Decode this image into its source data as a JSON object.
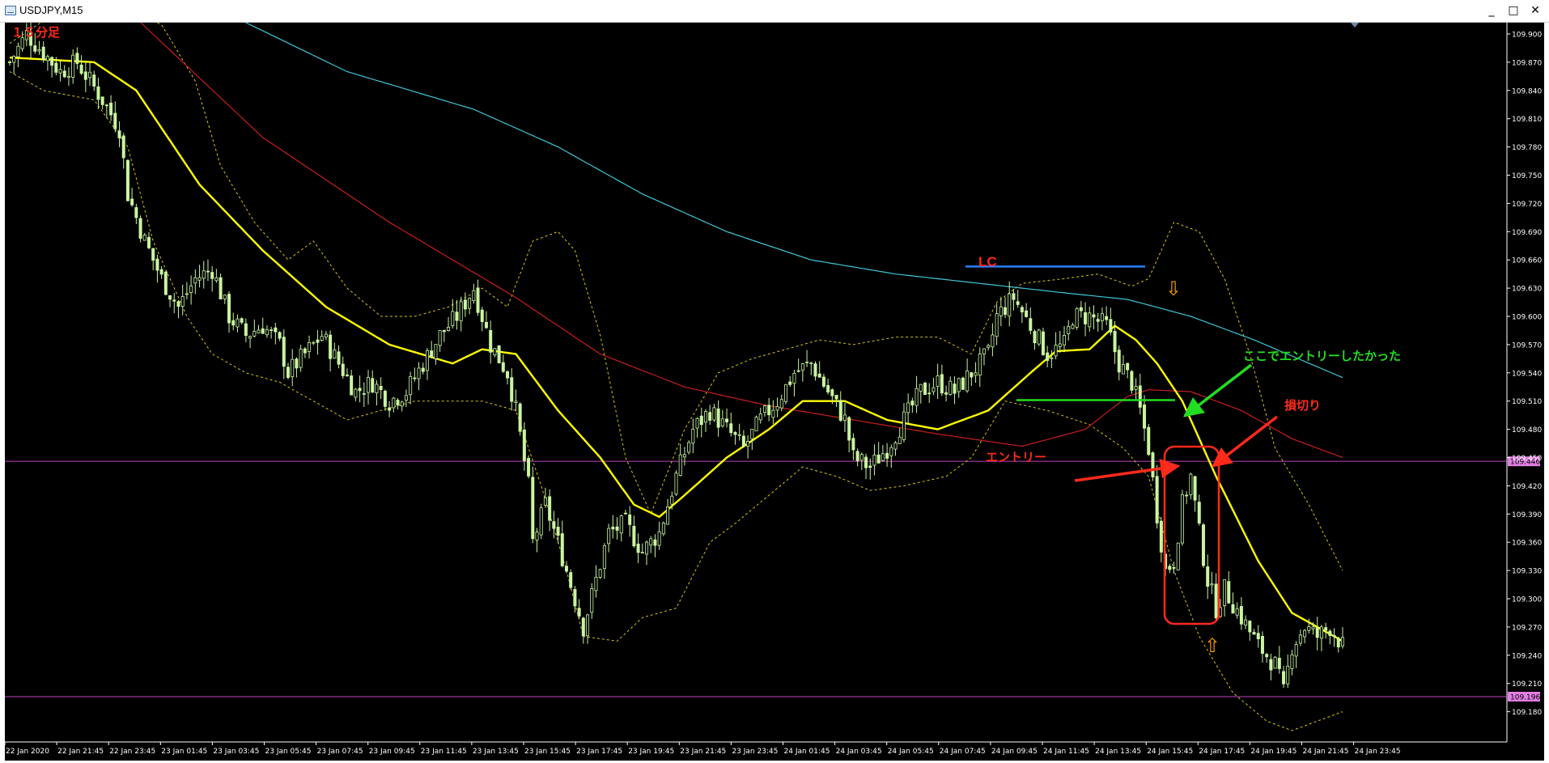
{
  "window": {
    "title": "USDJPY,M15",
    "buttons": {
      "minimize": "_",
      "maximize": "□",
      "close": "✕"
    }
  },
  "annotations": {
    "timeframe_label": "１５分足",
    "lc_label": "LC",
    "wanted_entry_label": "ここでエントリーしたかった",
    "stop_loss_label": "損切り",
    "entry_label": "エントリー",
    "down_arrow_glyph": "⇩",
    "up_arrow_glyph": "⇧"
  },
  "colors": {
    "background": "#000000",
    "candle": "#c9f5a0",
    "sma_fast": "#ffff00",
    "sma_mid": "#c81e1e",
    "sma_slow": "#3fc6d6",
    "bollinger": "#d6c619",
    "level_line": "#c040c0",
    "level_label_bg": "#e27ee2",
    "annotation_red": "#ff2a1a",
    "annotation_green": "#22dd22",
    "lc_blue": "#2a7fff",
    "arrow_orange": "#ff9c00",
    "axis_text": "#ffffff"
  },
  "chart_data": {
    "type": "candlestick",
    "symbol": "USDJPY",
    "timeframe": "M15",
    "ylim": [
      109.165,
      109.925
    ],
    "y_ticks": [
      "109.900",
      "109.870",
      "109.840",
      "109.810",
      "109.780",
      "109.750",
      "109.720",
      "109.690",
      "109.660",
      "109.630",
      "109.600",
      "109.570",
      "109.540",
      "109.510",
      "109.480",
      "109.450",
      "109.420",
      "109.390",
      "109.360",
      "109.330",
      "109.300",
      "109.270",
      "109.240",
      "109.210",
      "109.180"
    ],
    "x_ticks": [
      "22 Jan 2020",
      "22 Jan 21:45",
      "22 Jan 23:45",
      "23 Jan 01:45",
      "23 Jan 03:45",
      "23 Jan 05:45",
      "23 Jan 07:45",
      "23 Jan 09:45",
      "23 Jan 11:45",
      "23 Jan 13:45",
      "23 Jan 15:45",
      "23 Jan 17:45",
      "23 Jan 19:45",
      "23 Jan 21:45",
      "23 Jan 23:45",
      "24 Jan 01:45",
      "24 Jan 03:45",
      "24 Jan 05:45",
      "24 Jan 07:45",
      "24 Jan 09:45",
      "24 Jan 11:45",
      "24 Jan 13:45",
      "24 Jan 15:45",
      "24 Jan 17:45",
      "24 Jan 19:45",
      "24 Jan 21:45",
      "24 Jan 23:45"
    ],
    "horizontal_levels": [
      {
        "value": 109.446,
        "label": "109.446"
      },
      {
        "value": 109.196,
        "label": "109.196"
      }
    ],
    "lc_line": {
      "value": 109.653,
      "from_bar": 234,
      "to_bar": 268
    },
    "wanted_entry_line": {
      "value": 109.511,
      "from_bar": 244,
      "to_bar": 274
    },
    "close_anchors": [
      [
        0,
        109.87
      ],
      [
        4,
        109.9
      ],
      [
        8,
        109.88
      ],
      [
        12,
        109.86
      ],
      [
        16,
        109.87
      ],
      [
        19,
        109.85
      ],
      [
        22,
        109.83
      ],
      [
        26,
        109.8
      ],
      [
        28,
        109.73
      ],
      [
        32,
        109.68
      ],
      [
        36,
        109.64
      ],
      [
        40,
        109.61
      ],
      [
        44,
        109.64
      ],
      [
        48,
        109.65
      ],
      [
        52,
        109.6
      ],
      [
        56,
        109.58
      ],
      [
        60,
        109.59
      ],
      [
        64,
        109.57
      ],
      [
        66,
        109.54
      ],
      [
        70,
        109.56
      ],
      [
        74,
        109.58
      ],
      [
        78,
        109.55
      ],
      [
        82,
        109.52
      ],
      [
        86,
        109.53
      ],
      [
        90,
        109.51
      ],
      [
        94,
        109.52
      ],
      [
        98,
        109.55
      ],
      [
        102,
        109.58
      ],
      [
        106,
        109.6
      ],
      [
        110,
        109.63
      ],
      [
        114,
        109.57
      ],
      [
        118,
        109.54
      ],
      [
        120,
        109.5
      ],
      [
        123,
        109.42
      ],
      [
        124,
        109.36
      ],
      [
        127,
        109.4
      ],
      [
        130,
        109.36
      ],
      [
        134,
        109.3
      ],
      [
        136,
        109.27
      ],
      [
        139,
        109.32
      ],
      [
        142,
        109.37
      ],
      [
        146,
        109.38
      ],
      [
        150,
        109.35
      ],
      [
        154,
        109.37
      ],
      [
        158,
        109.43
      ],
      [
        162,
        109.48
      ],
      [
        166,
        109.5
      ],
      [
        170,
        109.48
      ],
      [
        174,
        109.46
      ],
      [
        178,
        109.49
      ],
      [
        182,
        109.51
      ],
      [
        186,
        109.54
      ],
      [
        190,
        109.55
      ],
      [
        194,
        109.52
      ],
      [
        198,
        109.49
      ],
      [
        200,
        109.45
      ],
      [
        204,
        109.44
      ],
      [
        208,
        109.46
      ],
      [
        212,
        109.49
      ],
      [
        216,
        109.52
      ],
      [
        220,
        109.53
      ],
      [
        224,
        109.52
      ],
      [
        228,
        109.54
      ],
      [
        232,
        109.56
      ],
      [
        234,
        109.6
      ],
      [
        238,
        109.62
      ],
      [
        242,
        109.59
      ],
      [
        246,
        109.56
      ],
      [
        250,
        109.57
      ],
      [
        252,
        109.6
      ],
      [
        256,
        109.6
      ],
      [
        260,
        109.59
      ],
      [
        263,
        109.55
      ],
      [
        266,
        109.53
      ],
      [
        268,
        109.5
      ],
      [
        270,
        109.46
      ],
      [
        272,
        109.39
      ],
      [
        274,
        109.33
      ],
      [
        276,
        109.34
      ],
      [
        278,
        109.4
      ],
      [
        280,
        109.43
      ],
      [
        282,
        109.37
      ],
      [
        284,
        109.32
      ],
      [
        286,
        109.29
      ],
      [
        288,
        109.31
      ],
      [
        292,
        109.28
      ],
      [
        296,
        109.25
      ],
      [
        300,
        109.23
      ],
      [
        302,
        109.2
      ],
      [
        304,
        109.25
      ],
      [
        307,
        109.27
      ],
      [
        310,
        109.26
      ],
      [
        313,
        109.27
      ],
      [
        316,
        109.25
      ]
    ],
    "sma_fast_anchors": [
      [
        0,
        109.875
      ],
      [
        20,
        109.87
      ],
      [
        30,
        109.84
      ],
      [
        45,
        109.74
      ],
      [
        60,
        109.67
      ],
      [
        75,
        109.61
      ],
      [
        90,
        109.57
      ],
      [
        105,
        109.55
      ],
      [
        112,
        109.565
      ],
      [
        120,
        109.56
      ],
      [
        130,
        109.5
      ],
      [
        140,
        109.45
      ],
      [
        148,
        109.4
      ],
      [
        154,
        109.387
      ],
      [
        160,
        109.41
      ],
      [
        170,
        109.45
      ],
      [
        180,
        109.48
      ],
      [
        188,
        109.51
      ],
      [
        198,
        109.51
      ],
      [
        208,
        109.49
      ],
      [
        220,
        109.48
      ],
      [
        232,
        109.5
      ],
      [
        242,
        109.54
      ],
      [
        248,
        109.563
      ],
      [
        256,
        109.565
      ],
      [
        262,
        109.59
      ],
      [
        267,
        109.575
      ],
      [
        272,
        109.55
      ],
      [
        278,
        109.51
      ],
      [
        286,
        109.43
      ],
      [
        296,
        109.34
      ],
      [
        304,
        109.285
      ],
      [
        310,
        109.27
      ],
      [
        316,
        109.255
      ]
    ],
    "sma_mid_anchors": [
      [
        28,
        109.925
      ],
      [
        60,
        109.79
      ],
      [
        90,
        109.7
      ],
      [
        120,
        109.62
      ],
      [
        140,
        109.56
      ],
      [
        160,
        109.525
      ],
      [
        180,
        109.505
      ],
      [
        200,
        109.49
      ],
      [
        220,
        109.475
      ],
      [
        240,
        109.462
      ],
      [
        255,
        109.48
      ],
      [
        265,
        109.515
      ],
      [
        270,
        109.522
      ],
      [
        280,
        109.52
      ],
      [
        292,
        109.5
      ],
      [
        304,
        109.47
      ],
      [
        316,
        109.45
      ]
    ],
    "sma_slow_anchors": [
      [
        50,
        109.925
      ],
      [
        80,
        109.86
      ],
      [
        110,
        109.82
      ],
      [
        130,
        109.78
      ],
      [
        150,
        109.73
      ],
      [
        170,
        109.69
      ],
      [
        190,
        109.66
      ],
      [
        210,
        109.645
      ],
      [
        230,
        109.635
      ],
      [
        250,
        109.625
      ],
      [
        265,
        109.618
      ],
      [
        280,
        109.6
      ],
      [
        295,
        109.575
      ],
      [
        316,
        109.535
      ]
    ],
    "bb_upper_anchors": [
      [
        0,
        109.89
      ],
      [
        10,
        109.92
      ],
      [
        20,
        109.93
      ],
      [
        28,
        109.925
      ],
      [
        36,
        109.91
      ],
      [
        44,
        109.85
      ],
      [
        50,
        109.76
      ],
      [
        58,
        109.7
      ],
      [
        66,
        109.66
      ],
      [
        72,
        109.68
      ],
      [
        80,
        109.63
      ],
      [
        88,
        109.6
      ],
      [
        96,
        109.6
      ],
      [
        104,
        109.61
      ],
      [
        112,
        109.63
      ],
      [
        118,
        109.61
      ],
      [
        124,
        109.68
      ],
      [
        130,
        109.69
      ],
      [
        134,
        109.67
      ],
      [
        140,
        109.58
      ],
      [
        146,
        109.45
      ],
      [
        152,
        109.39
      ],
      [
        160,
        109.48
      ],
      [
        168,
        109.54
      ],
      [
        176,
        109.555
      ],
      [
        184,
        109.565
      ],
      [
        192,
        109.575
      ],
      [
        200,
        109.57
      ],
      [
        210,
        109.578
      ],
      [
        220,
        109.578
      ],
      [
        228,
        109.56
      ],
      [
        234,
        109.615
      ],
      [
        240,
        109.635
      ],
      [
        250,
        109.64
      ],
      [
        258,
        109.645
      ],
      [
        266,
        109.632
      ],
      [
        270,
        109.64
      ],
      [
        276,
        109.7
      ],
      [
        282,
        109.69
      ],
      [
        288,
        109.64
      ],
      [
        294,
        109.56
      ],
      [
        300,
        109.46
      ],
      [
        308,
        109.4
      ],
      [
        316,
        109.33
      ]
    ],
    "bb_lower_anchors": [
      [
        0,
        109.86
      ],
      [
        8,
        109.84
      ],
      [
        20,
        109.83
      ],
      [
        28,
        109.78
      ],
      [
        34,
        109.68
      ],
      [
        42,
        109.6
      ],
      [
        48,
        109.56
      ],
      [
        56,
        109.54
      ],
      [
        64,
        109.53
      ],
      [
        72,
        109.51
      ],
      [
        80,
        109.49
      ],
      [
        88,
        109.5
      ],
      [
        96,
        109.51
      ],
      [
        104,
        109.51
      ],
      [
        112,
        109.51
      ],
      [
        120,
        109.5
      ],
      [
        126,
        109.42
      ],
      [
        132,
        109.33
      ],
      [
        136,
        109.26
      ],
      [
        144,
        109.255
      ],
      [
        150,
        109.28
      ],
      [
        158,
        109.29
      ],
      [
        166,
        109.36
      ],
      [
        172,
        109.38
      ],
      [
        180,
        109.41
      ],
      [
        188,
        109.44
      ],
      [
        196,
        109.43
      ],
      [
        204,
        109.415
      ],
      [
        212,
        109.42
      ],
      [
        222,
        109.43
      ],
      [
        228,
        109.45
      ],
      [
        236,
        109.51
      ],
      [
        246,
        109.5
      ],
      [
        256,
        109.485
      ],
      [
        264,
        109.46
      ],
      [
        270,
        109.43
      ],
      [
        276,
        109.33
      ],
      [
        282,
        109.26
      ],
      [
        290,
        109.2
      ],
      [
        298,
        109.17
      ],
      [
        304,
        109.16
      ],
      [
        310,
        109.17
      ],
      [
        316,
        109.18
      ]
    ]
  }
}
